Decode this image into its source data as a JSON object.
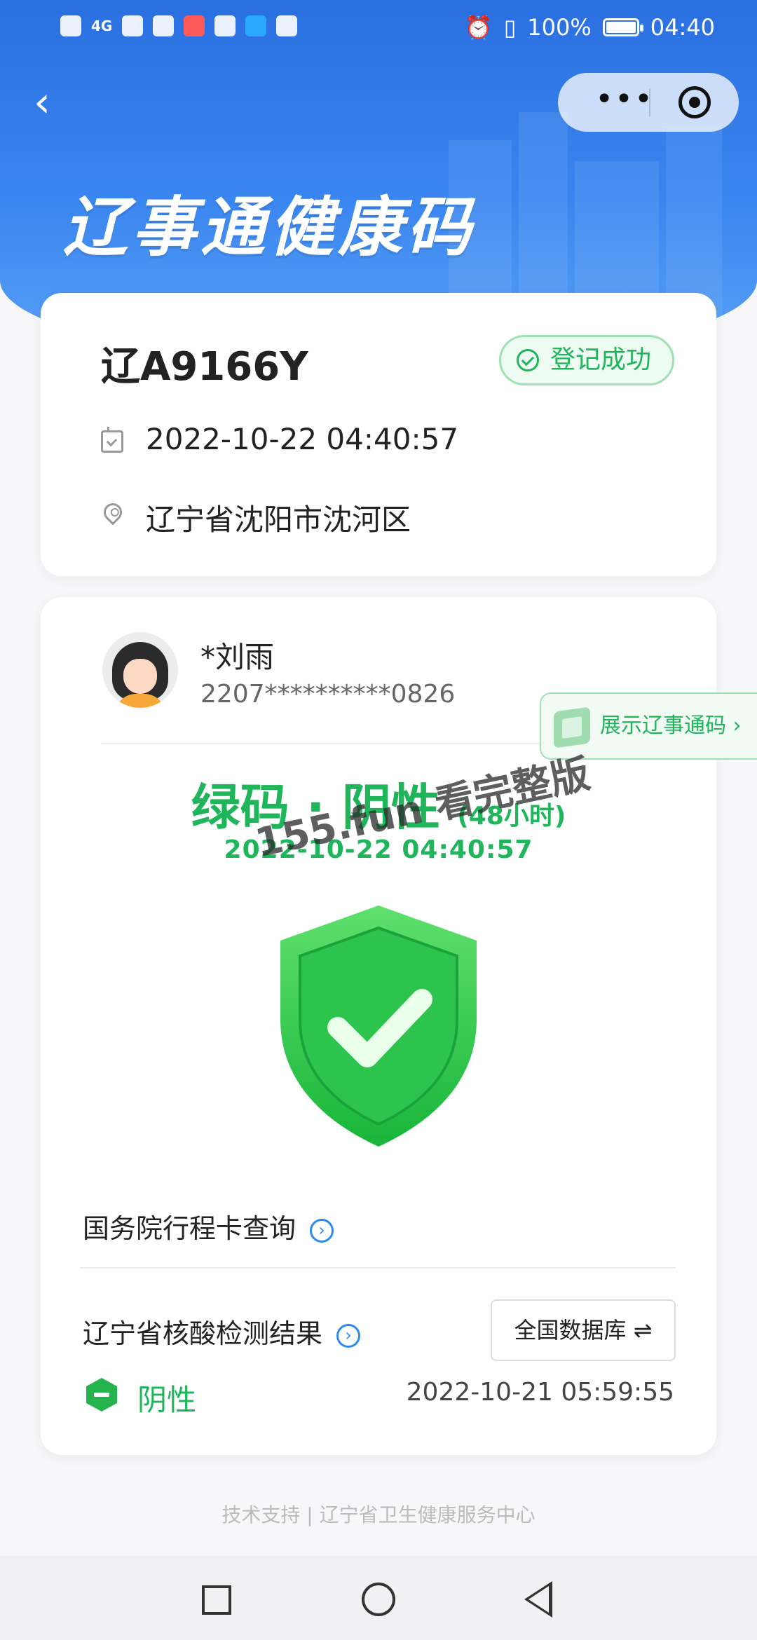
{
  "status_bar": {
    "network": "4G",
    "battery": "100%",
    "time": "04:40"
  },
  "header": {
    "title": "辽事通健康码"
  },
  "registration": {
    "plate": "辽A9166Y",
    "badge": "登记成功",
    "datetime": "2022-10-22 04:40:57",
    "location": "辽宁省沈阳市沈河区"
  },
  "person": {
    "name": "*刘雨",
    "id_number": "2207**********0826",
    "pass_button": "展示辽事通码"
  },
  "health_status": {
    "title": "绿码 · 阴性",
    "duration": "(48小时)",
    "time": "2022-10-22 04:40:57",
    "color": "#1fb55a"
  },
  "watermark": "155.fun 看完整版",
  "itinerary": {
    "label": "国务院行程卡查询"
  },
  "nucleic_test": {
    "label": "辽宁省核酸检测结果",
    "db_button": "全国数据库",
    "result": "阴性",
    "result_time": "2022-10-21 05:59:55"
  },
  "footer": {
    "text": "技术支持 | 辽宁省卫生健康服务中心"
  }
}
